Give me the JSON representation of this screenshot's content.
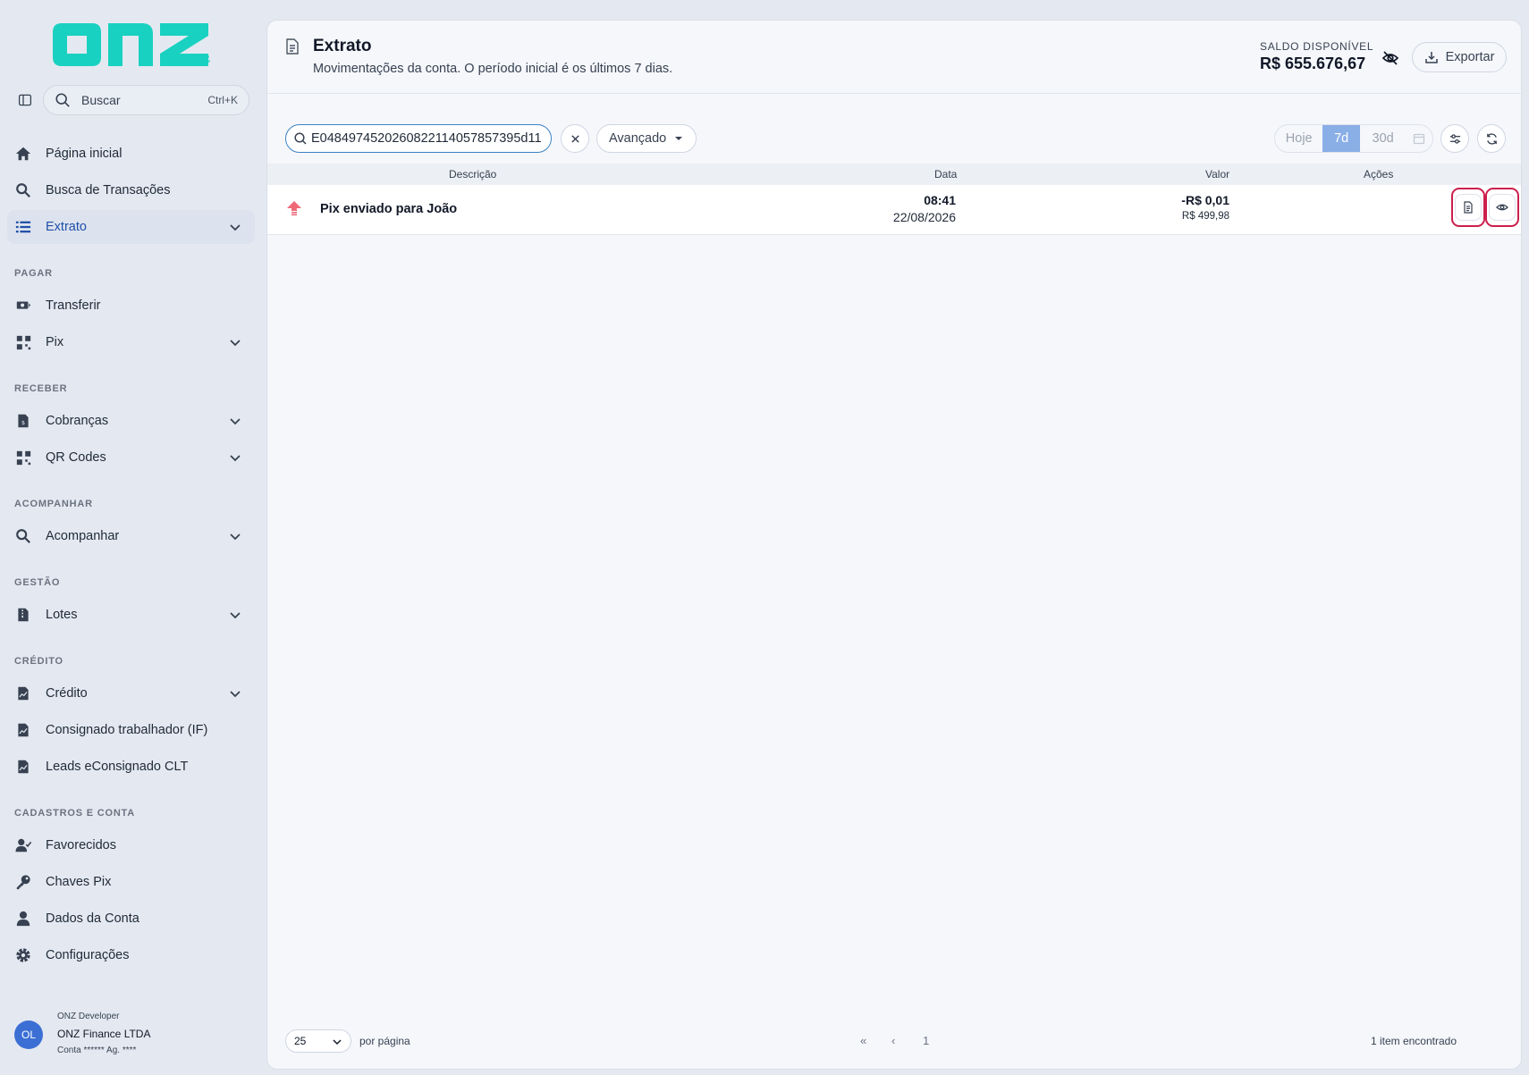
{
  "brand": {
    "logo_text": "onz",
    "accent": "#19d1c0"
  },
  "sidebar": {
    "search": {
      "label": "Buscar",
      "shortcut": "Ctrl+K"
    },
    "top_items": [
      {
        "label": "Página inicial",
        "icon": "home-icon"
      },
      {
        "label": "Busca de Transações",
        "icon": "search-icon"
      },
      {
        "label": "Extrato",
        "icon": "list-icon",
        "active": true
      }
    ],
    "sections": [
      {
        "label": "PAGAR",
        "items": [
          {
            "label": "Transferir",
            "icon": "money-transfer-icon"
          },
          {
            "label": "Pix",
            "icon": "qr-grid-icon"
          }
        ]
      },
      {
        "label": "RECEBER",
        "items": [
          {
            "label": "Cobranças",
            "icon": "invoice-icon"
          },
          {
            "label": "QR Codes",
            "icon": "qr-grid-icon"
          }
        ]
      },
      {
        "label": "ACOMPANHAR",
        "items": [
          {
            "label": "Acompanhar",
            "icon": "search-icon"
          }
        ]
      },
      {
        "label": "GESTÃO",
        "items": [
          {
            "label": "Lotes",
            "icon": "zip-file-icon"
          }
        ]
      },
      {
        "label": "CRÉDITO",
        "items": [
          {
            "label": "Crédito",
            "icon": "chart-file-icon"
          },
          {
            "label": "Consignado trabalhador (IF)",
            "icon": "chart-file-icon"
          },
          {
            "label": "Leads eConsignado CLT",
            "icon": "chart-file-icon"
          }
        ]
      },
      {
        "label": "CADASTROS E CONTA",
        "items": [
          {
            "label": "Favorecidos",
            "icon": "user-check-icon"
          },
          {
            "label": "Chaves Pix",
            "icon": "key-icon"
          },
          {
            "label": "Dados da Conta",
            "icon": "user-icon"
          },
          {
            "label": "Configurações",
            "icon": "gear-icon"
          }
        ]
      }
    ],
    "user": {
      "initials": "OL",
      "role": "ONZ Developer",
      "company": "ONZ Finance LTDA",
      "account": "Conta ****** Ag. ****"
    }
  },
  "header": {
    "title": "Extrato",
    "subtitle": "Movimentações da conta. O período inicial é os últimos 7 dias.",
    "balance_label": "SALDO DISPONÍVEL",
    "balance_value": "R$ 655.676,67",
    "export_label": "Exportar"
  },
  "filters": {
    "query_value": "E0484974520260822114057857395d11",
    "advanced_label": "Avançado",
    "periods": [
      "Hoje",
      "7d",
      "30d"
    ],
    "selected_period": "7d"
  },
  "table": {
    "columns": [
      "Descrição",
      "Data",
      "Valor",
      "Ações"
    ],
    "rows": [
      {
        "description": "Pix enviado para João",
        "time": "08:41",
        "date": "22/08/2026",
        "amount": "-R$ 0,01",
        "balance_after": "R$ 499,98",
        "direction": "out"
      }
    ]
  },
  "footer": {
    "per_page": "25",
    "per_page_label": "por página",
    "first_label": "«",
    "prev_label": "‹",
    "current_page": "1",
    "found_label": "1 item encontrado"
  }
}
